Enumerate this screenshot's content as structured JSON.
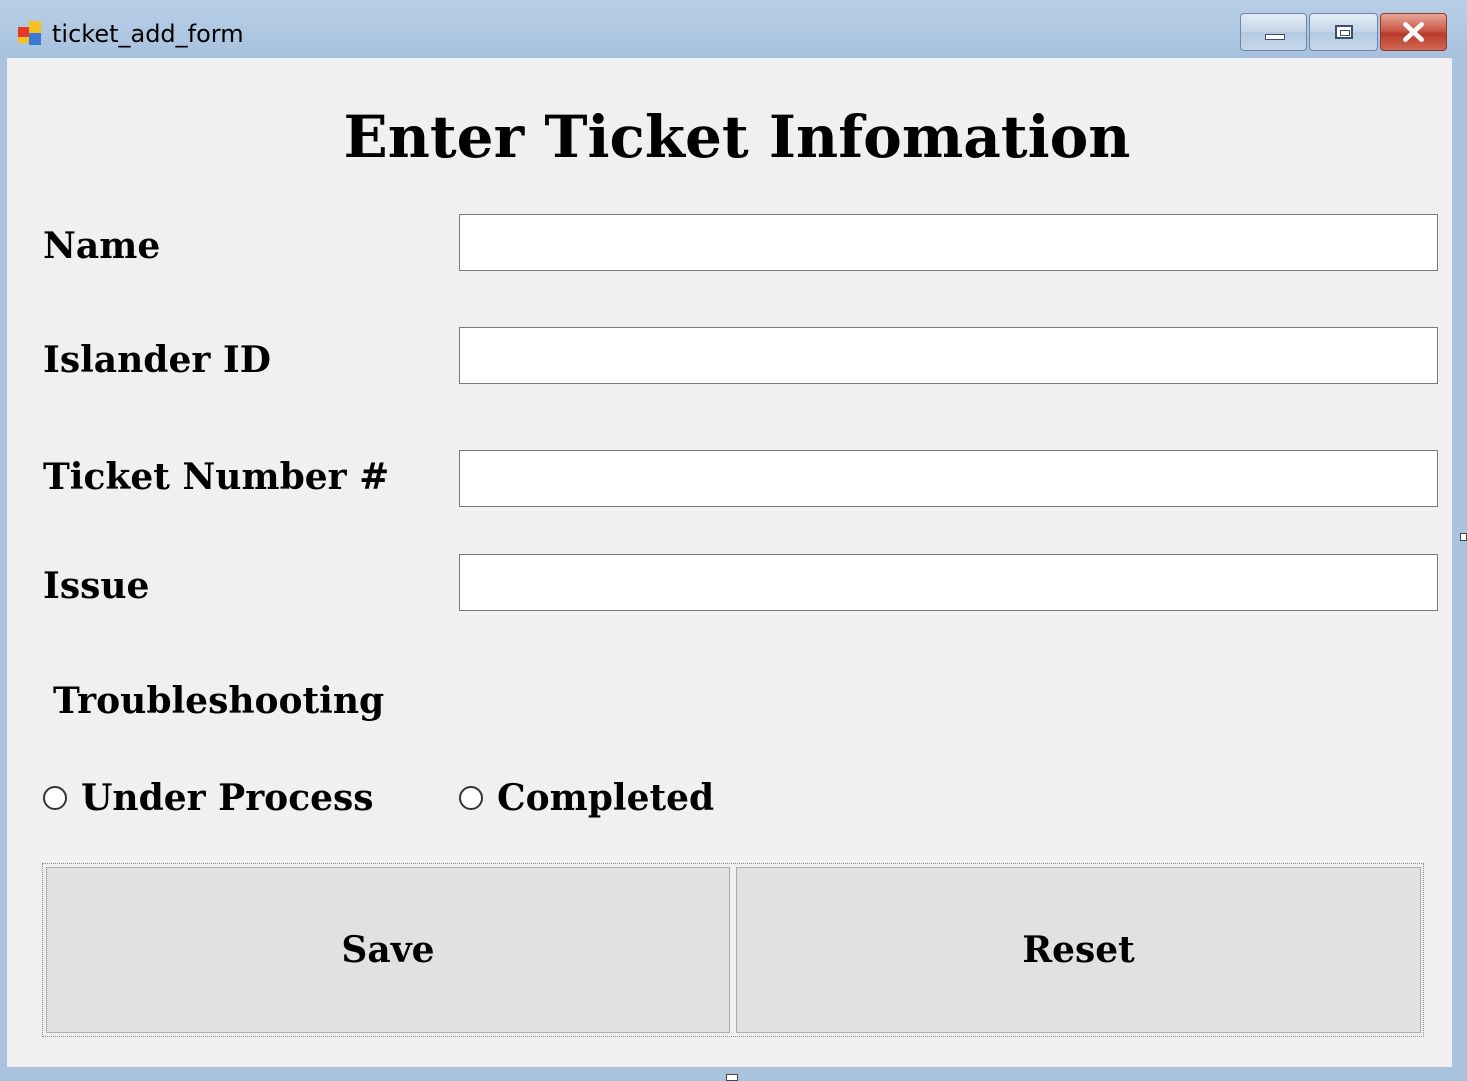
{
  "window": {
    "title": "ticket_add_form",
    "controls": {
      "minimize": "minimize",
      "maximize": "maximize",
      "close": "close"
    }
  },
  "form": {
    "heading": "Enter Ticket Infomation",
    "fields": {
      "name": {
        "label": "Name",
        "value": ""
      },
      "islander_id": {
        "label": "Islander ID",
        "value": ""
      },
      "ticket_number": {
        "label": "Ticket Number #",
        "value": ""
      },
      "issue": {
        "label": "Issue",
        "value": ""
      }
    },
    "troubleshooting": {
      "label": "Troubleshooting",
      "options": [
        {
          "label": "Under Process",
          "checked": false
        },
        {
          "label": "Completed",
          "checked": false
        }
      ]
    },
    "buttons": {
      "save": "Save",
      "reset": "Reset"
    }
  }
}
